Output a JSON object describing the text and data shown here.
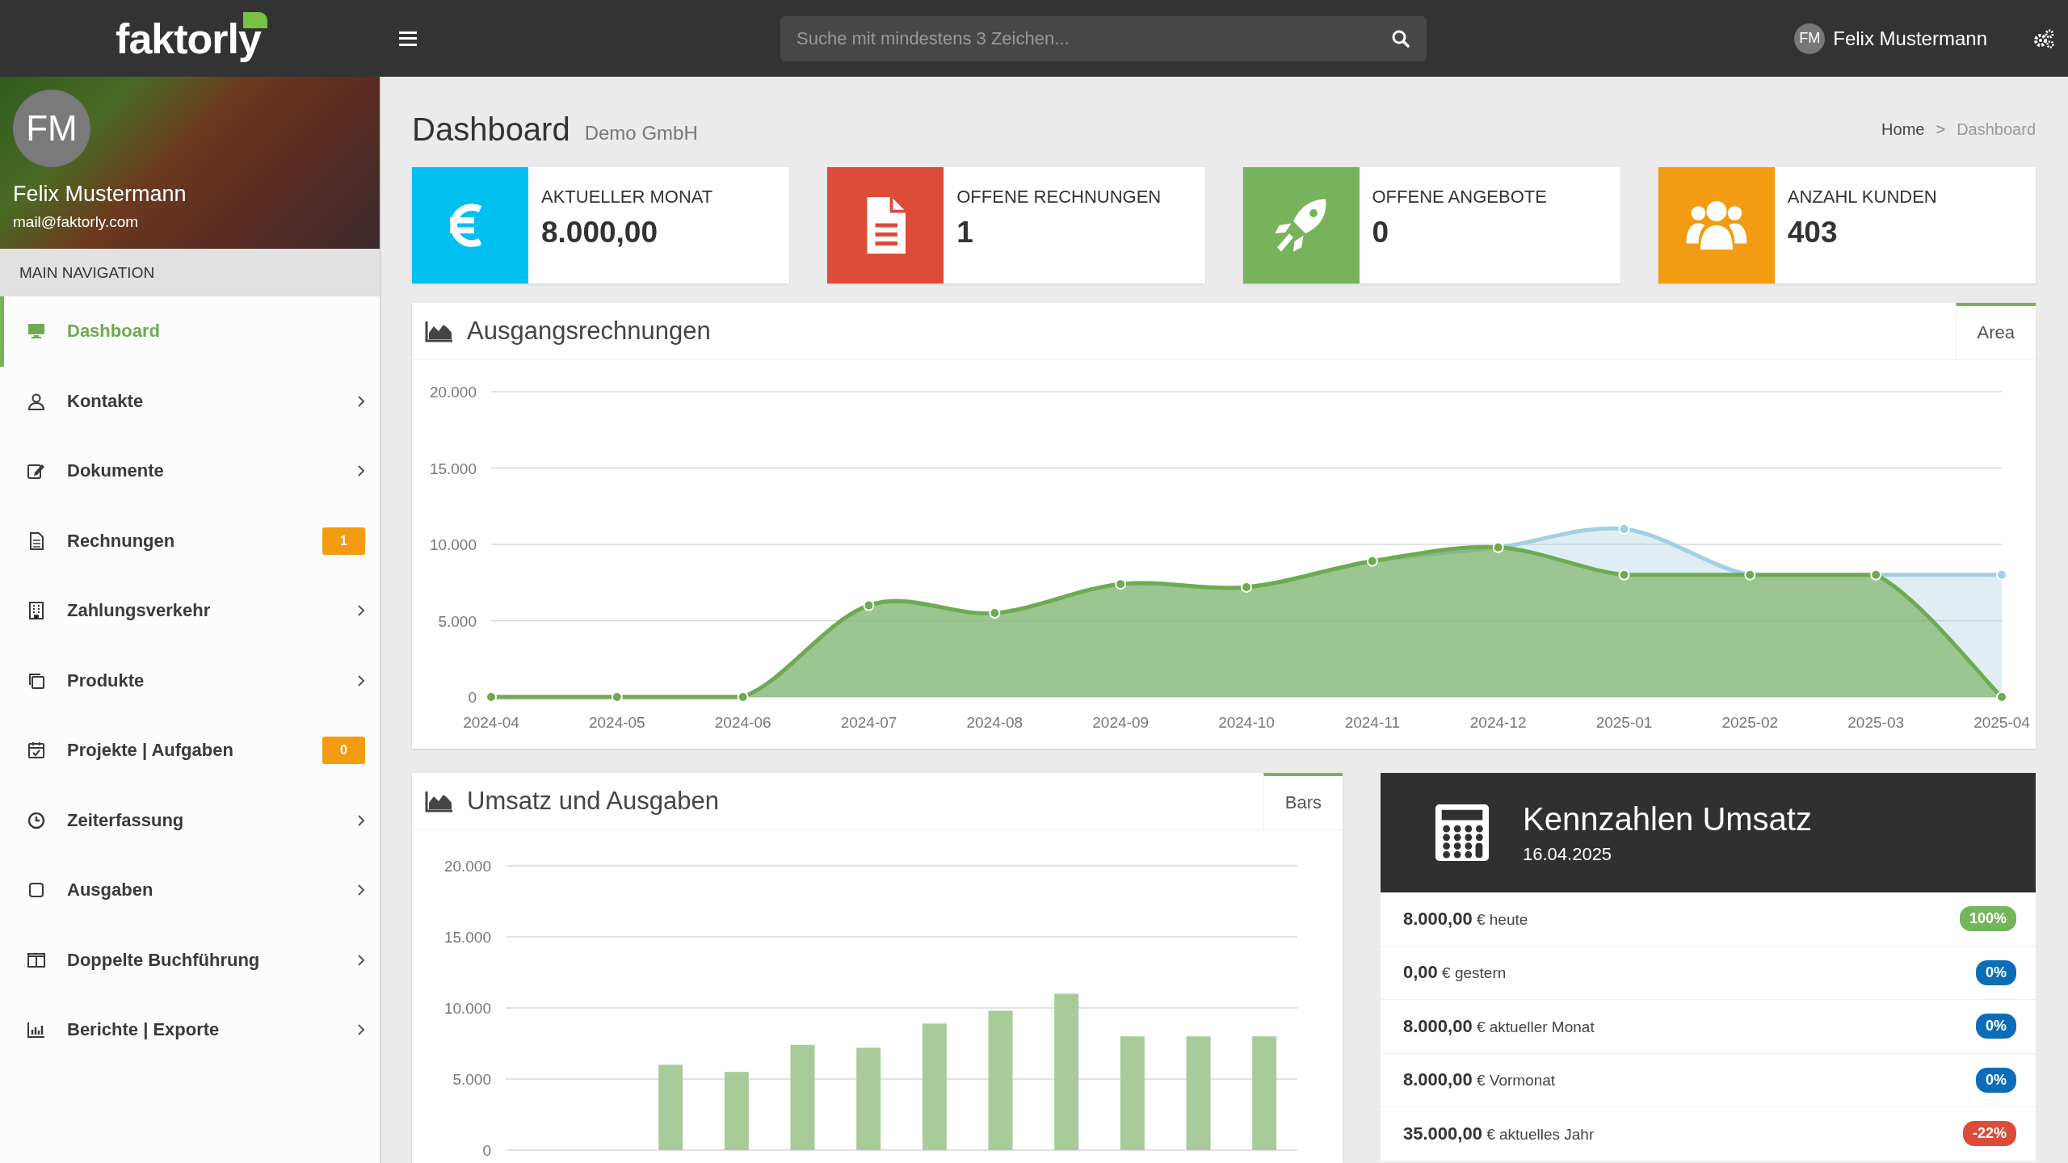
{
  "header": {
    "logo": "faktorly",
    "search": {
      "placeholder": "Suche mit mindestens 3 Zeichen..."
    },
    "user": {
      "initials": "FM",
      "name": "Felix Mustermann"
    }
  },
  "sidebar": {
    "profile": {
      "initials": "FM",
      "name": "Felix Mustermann",
      "email": "mail@faktorly.com"
    },
    "section": "MAIN NAVIGATION",
    "items": [
      {
        "label": "Dashboard",
        "selected": true,
        "expandable": false
      },
      {
        "label": "Kontakte",
        "selected": false,
        "expandable": true
      },
      {
        "label": "Dokumente",
        "selected": false,
        "expandable": true
      },
      {
        "label": "Rechnungen",
        "selected": false,
        "expandable": false,
        "badge": "1"
      },
      {
        "label": "Zahlungsverkehr",
        "selected": false,
        "expandable": true
      },
      {
        "label": "Produkte",
        "selected": false,
        "expandable": true
      },
      {
        "label": "Projekte | Aufgaben",
        "selected": false,
        "expandable": false,
        "badge": "0"
      },
      {
        "label": "Zeiterfassung",
        "selected": false,
        "expandable": true
      },
      {
        "label": "Ausgaben",
        "selected": false,
        "expandable": true
      },
      {
        "label": "Doppelte Buchführung",
        "selected": false,
        "expandable": true
      },
      {
        "label": "Berichte | Exporte",
        "selected": false,
        "expandable": true
      }
    ]
  },
  "page": {
    "title": "Dashboard",
    "subtitle": "Demo GmbH",
    "breadcrumb": {
      "items": [
        "Home",
        "Dashboard"
      ],
      "separator": ">"
    }
  },
  "stats": [
    {
      "label": "AKTUELLER MONAT",
      "value": "8.000,00",
      "color": "#00c0ef"
    },
    {
      "label": "OFFENE RECHNUNGEN",
      "value": "1",
      "color": "#dd4b39"
    },
    {
      "label": "OFFENE ANGEBOTE",
      "value": "0",
      "color": "#77b35b"
    },
    {
      "label": "ANZAHL KUNDEN",
      "value": "403",
      "color": "#f39c12"
    }
  ],
  "area_panel": {
    "title": "Ausgangsrechnungen",
    "tab": {
      "label": "Area",
      "selected": true
    },
    "chart_data": {
      "type": "area",
      "categories": [
        "2024-04",
        "2024-05",
        "2024-06",
        "2024-07",
        "2024-08",
        "2024-09",
        "2024-10",
        "2024-11",
        "2024-12",
        "2025-01",
        "2025-02",
        "2025-03",
        "2025-04"
      ],
      "series": [
        {
          "color": "#a3cfe2",
          "values": [
            0,
            0,
            0,
            6000,
            5500,
            7400,
            7200,
            8900,
            9800,
            11000,
            8000,
            8000,
            8000
          ]
        },
        {
          "color": "#6eab50",
          "values": [
            0,
            0,
            0,
            6000,
            5500,
            7400,
            7200,
            8900,
            9800,
            8000,
            8000,
            8000,
            0
          ]
        }
      ],
      "ylim": [
        0,
        20000
      ],
      "grid": true,
      "yticks": [
        {
          "value": 0,
          "label": "0"
        },
        {
          "value": 5000,
          "label": "5.000"
        },
        {
          "value": 10000,
          "label": "10.000"
        },
        {
          "value": 15000,
          "label": "15.000"
        },
        {
          "value": 20000,
          "label": "20.000"
        }
      ]
    }
  },
  "bar_panel": {
    "title": "Umsatz und Ausgaben",
    "tab": {
      "label": "Bars",
      "selected": true
    },
    "chart_data": {
      "type": "bar",
      "series": [
        {
          "color": "#a8cb9a",
          "values": [
            0,
            0,
            6000,
            5500,
            7400,
            7200,
            8900,
            9800,
            11000,
            8000,
            8000,
            8000
          ]
        }
      ],
      "ylim": [
        0,
        20000
      ],
      "grid": true,
      "yticks": [
        {
          "value": 0,
          "label": "0"
        },
        {
          "value": 5000,
          "label": "5.000"
        },
        {
          "value": 10000,
          "label": "10.000"
        },
        {
          "value": 15000,
          "label": "15.000"
        },
        {
          "value": 20000,
          "label": "20.000"
        }
      ]
    }
  },
  "kpi": {
    "title": "Kennzahlen Umsatz",
    "date": "16.04.2025",
    "rows": [
      {
        "text": "**8.000,00** € heute",
        "badge": "100%",
        "color": "#72b55a"
      },
      {
        "text": "**0,00** € gestern",
        "badge": "0%",
        "color": "#0b6db8"
      },
      {
        "text": "**8.000,00** € aktueller Monat",
        "badge": "0%",
        "color": "#0b6db8"
      },
      {
        "text": "**8.000,00** € Vormonat",
        "badge": "0%",
        "color": "#0b6db8"
      },
      {
        "text": "**35.000,00** € aktuelles Jahr",
        "badge": "-22%",
        "color": "#dd4b39"
      }
    ]
  }
}
